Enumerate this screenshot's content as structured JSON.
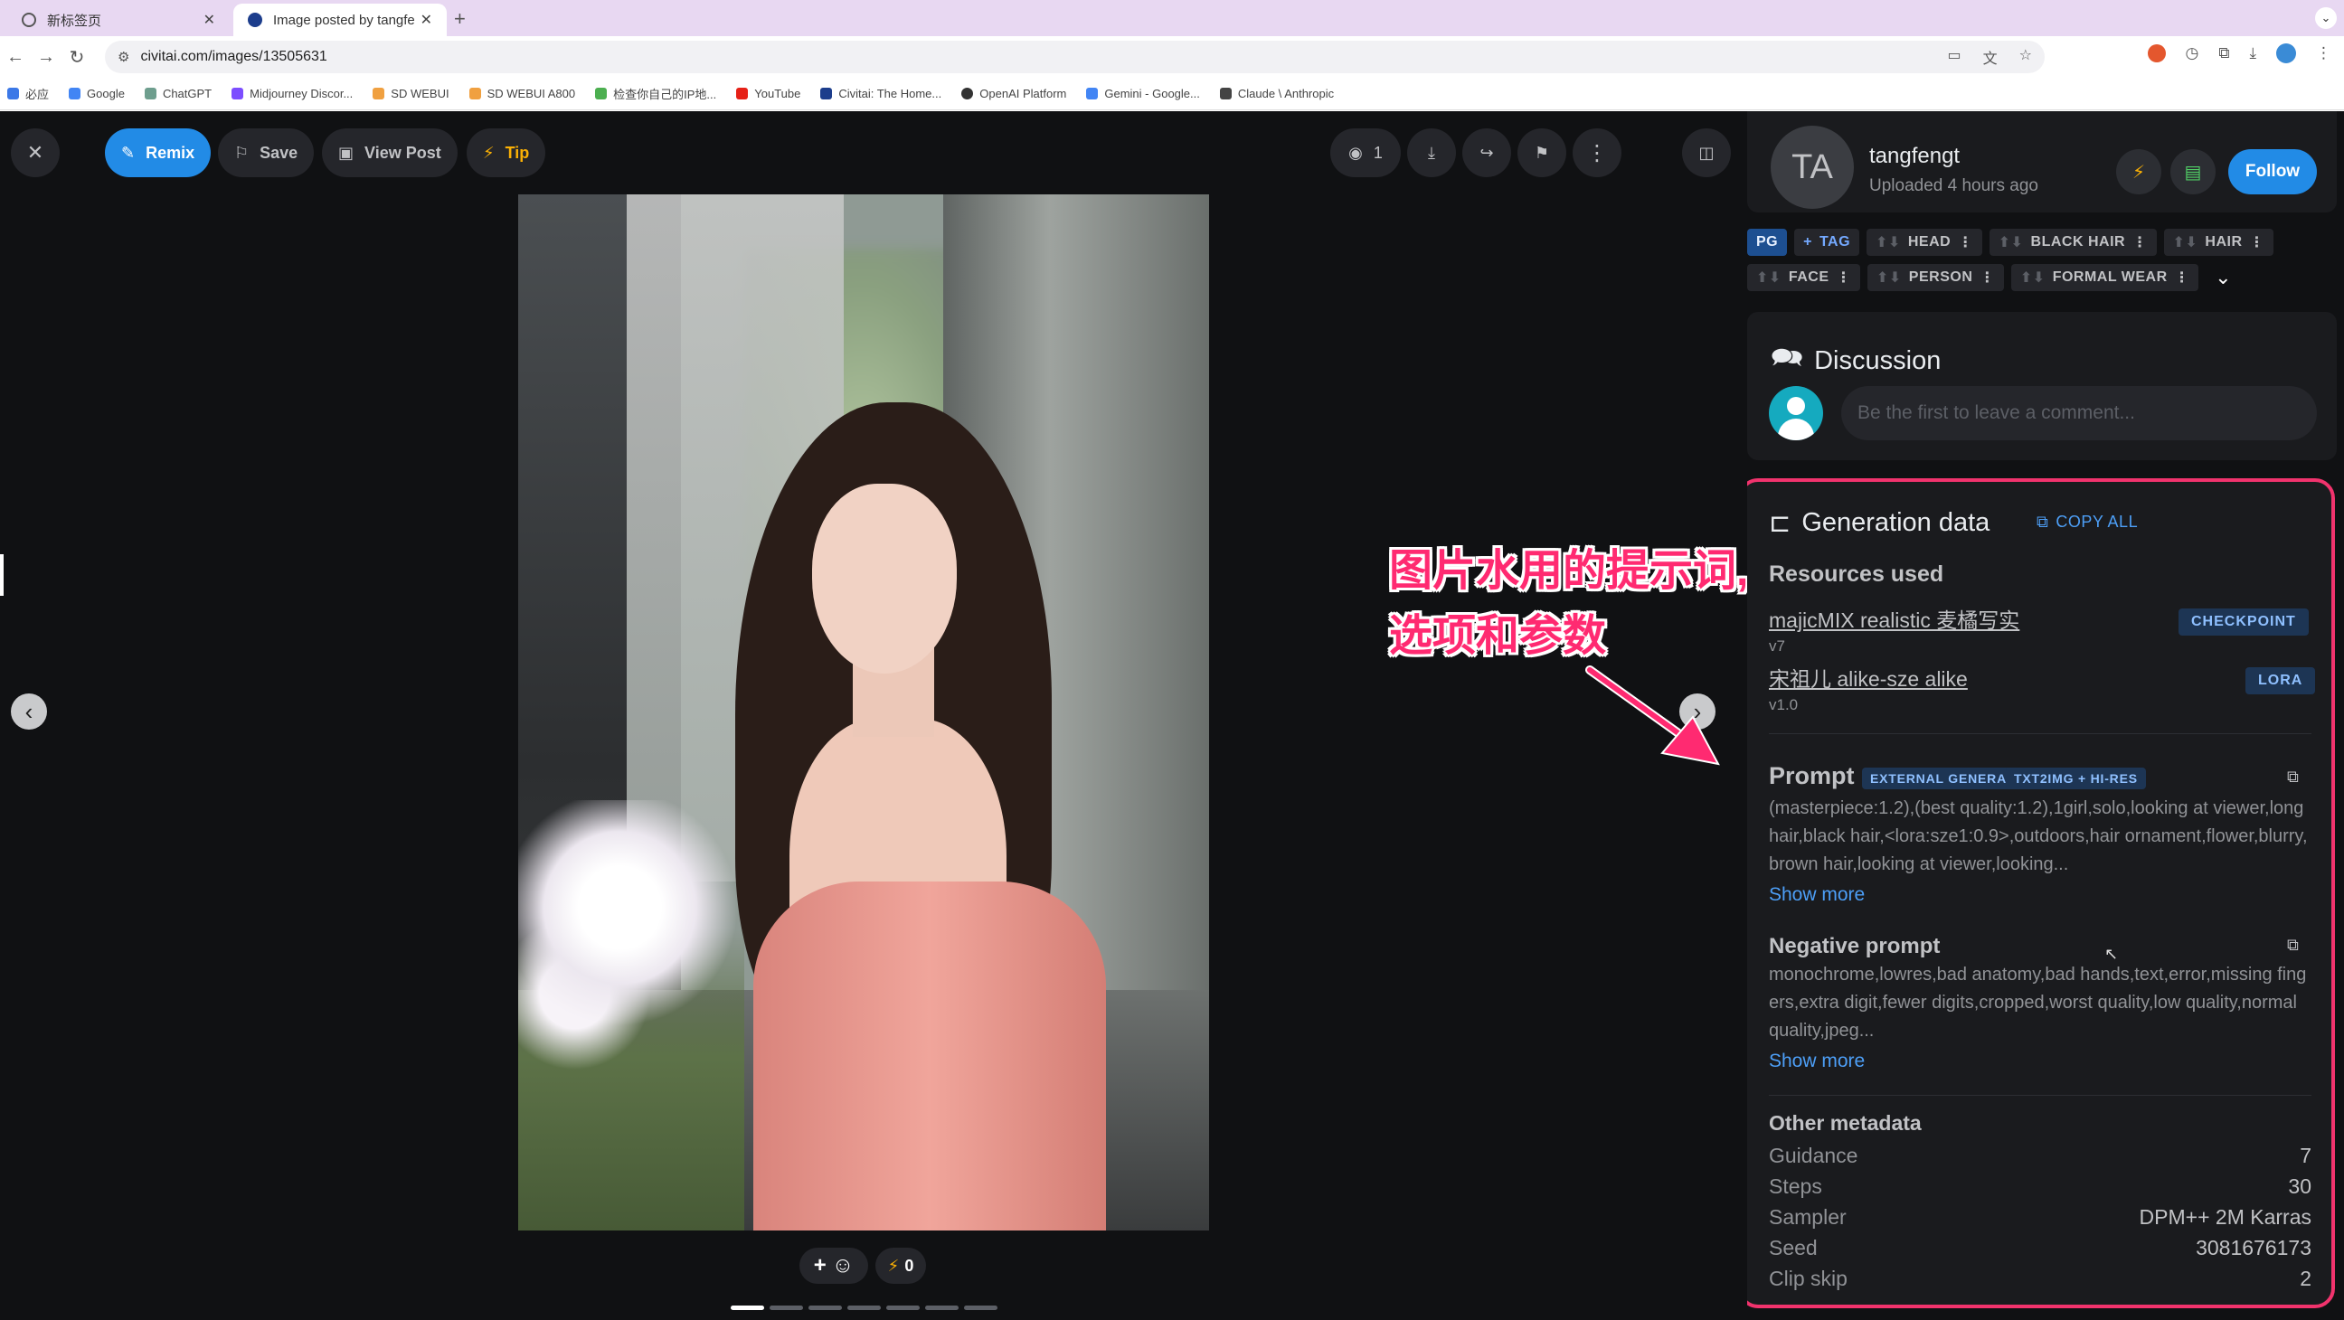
{
  "browser": {
    "tabs": [
      {
        "title": "新标签页",
        "active": false
      },
      {
        "title": "Image posted by tangfengt",
        "active": true
      }
    ],
    "url": "civitai.com/images/13505631",
    "bookmarks": [
      "必应",
      "Google",
      "ChatGPT",
      "Midjourney Discor...",
      "SD WEBUI",
      "SD WEBUI A800",
      "检查你自己的IP地...",
      "YouTube",
      "Civitai: The Home...",
      "OpenAI Platform",
      "Gemini - Google...",
      "Claude \\ Anthropic"
    ]
  },
  "toolbar": {
    "remix": "Remix",
    "save": "Save",
    "view_post": "View Post",
    "tip": "Tip",
    "views": "1"
  },
  "reactions": {
    "buzz_count": "0"
  },
  "annotation": {
    "line1": "图片水用的提示词,",
    "line2": "选项和参数"
  },
  "user": {
    "initials": "TA",
    "name": "tangfengt",
    "uploaded": "Uploaded 4 hours ago",
    "follow": "Follow"
  },
  "tags": {
    "rating": "PG",
    "add": "TAG",
    "row1": [
      "HEAD",
      "BLACK HAIR",
      "HAIR"
    ],
    "row2": [
      "FACE",
      "PERSON",
      "FORMAL WEAR"
    ]
  },
  "discussion": {
    "title": "Discussion",
    "placeholder": "Be the first to leave a comment..."
  },
  "generation": {
    "title": "Generation data",
    "copy_all": "COPY ALL",
    "resources_title": "Resources used",
    "resources": [
      {
        "name": "majicMIX realistic 麦橘写实",
        "version": "v7",
        "type": "CHECKPOINT"
      },
      {
        "name": "宋祖儿 alike-sze alike",
        "version": "v1.0",
        "type": "LORA"
      }
    ],
    "prompt": {
      "title": "Prompt",
      "badges": [
        "EXTERNAL GENERATOR",
        "TXT2IMG + HI-RES"
      ],
      "text": "(masterpiece:1.2),(best quality:1.2),1girl,solo,looking at viewer,long hair,black hair,<lora:sze1:0.9>,outdoors,hair ornament,flower,blurry,brown hair,looking at viewer,looking...",
      "show_more": "Show more"
    },
    "negative": {
      "title": "Negative prompt",
      "text": "monochrome,lowres,bad anatomy,bad hands,text,error,missing fingers,extra digit,fewer digits,cropped,worst quality,low quality,normal quality,jpeg...",
      "show_more": "Show more"
    },
    "other_title": "Other metadata",
    "metadata": [
      {
        "label": "Guidance",
        "value": "7"
      },
      {
        "label": "Steps",
        "value": "30"
      },
      {
        "label": "Sampler",
        "value": "DPM++ 2M Karras"
      },
      {
        "label": "Seed",
        "value": "3081676173"
      },
      {
        "label": "Clip skip",
        "value": "2"
      }
    ]
  },
  "colors": {
    "accent": "#228be6",
    "highlight": "#f1336d",
    "panel": "#1a1b1e",
    "page": "#101113"
  }
}
